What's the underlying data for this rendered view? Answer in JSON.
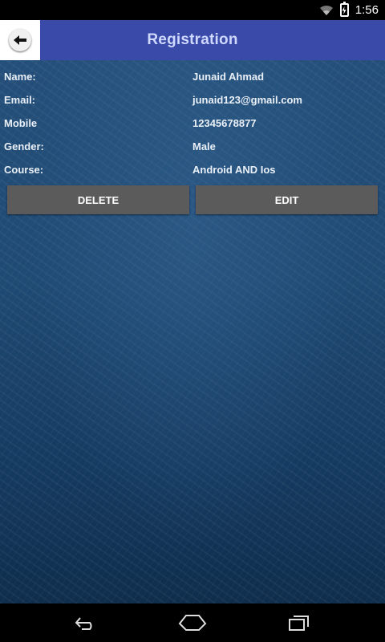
{
  "status_bar": {
    "time": "1:56"
  },
  "app_bar": {
    "title": "Registration"
  },
  "details": [
    {
      "label": "Name:",
      "value": "Junaid Ahmad"
    },
    {
      "label": "Email:",
      "value": "junaid123@gmail.com"
    },
    {
      "label": "Mobile",
      "value": "12345678877"
    },
    {
      "label": "Gender:",
      "value": "Male"
    },
    {
      "label": "Course:",
      "value": "Android AND Ios"
    }
  ],
  "actions": {
    "delete_label": "DELETE",
    "edit_label": "EDIT"
  },
  "colors": {
    "app_bar": "#3a4aa8",
    "button": "#5b5b5b",
    "background": "#1f4a73"
  },
  "icons": {
    "back": "arrow-back-icon",
    "wifi": "wifi-icon",
    "battery": "battery-charging-icon",
    "nav_back": "nav-back-icon",
    "nav_home": "nav-home-icon",
    "nav_recents": "nav-recents-icon"
  }
}
